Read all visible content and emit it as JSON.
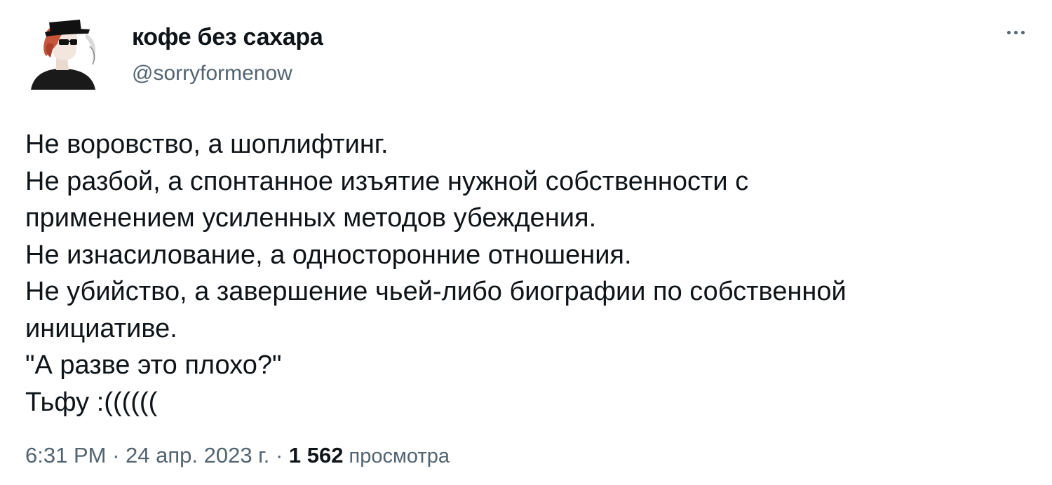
{
  "author": {
    "display_name": "кофе без сахара",
    "handle": "@sorryformenow"
  },
  "tweet": {
    "lines": [
      "Не воровство, а шоплифтинг.",
      "Не разбой, а спонтанное изъятие нужной собственности с",
      "применением усиленных методов убеждения.",
      "Не изнасилование, а односторонние отношения.",
      "Не убийство, а завершение чьей-либо биографии по собственной",
      "инициативе.",
      "\"А разве это плохо?\"",
      "Тьфу :(((((("
    ]
  },
  "meta": {
    "time": "6:31 PM",
    "separator_1": " · ",
    "date": "24 апр. 2023 г.",
    "separator_2": " · ",
    "views_count": "1 562",
    "views_label": " просмотра"
  },
  "icons": {
    "more": "more-horizontal-icon",
    "avatar": "avatar-image"
  },
  "colors": {
    "text_primary": "#0f1419",
    "text_secondary": "#536471",
    "background": "#ffffff"
  }
}
